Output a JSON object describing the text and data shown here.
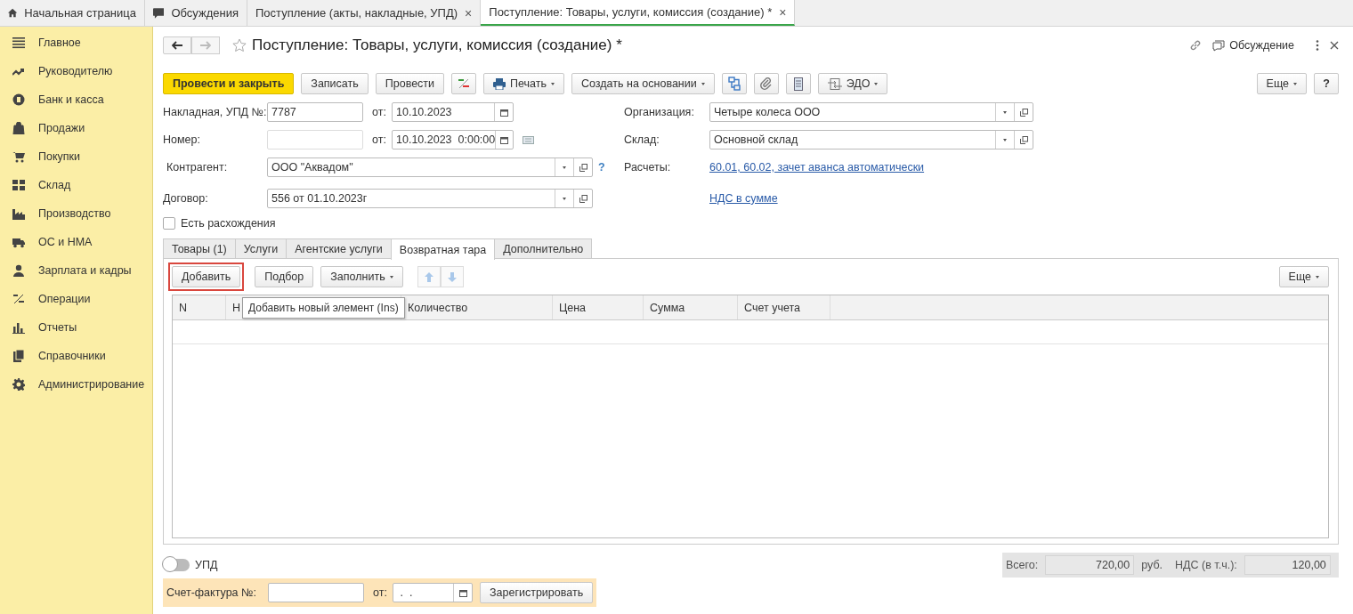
{
  "top_tabs": [
    {
      "label": "Начальная страница",
      "selected": false
    },
    {
      "label": "Обсуждения",
      "selected": false
    },
    {
      "label": "Поступление (акты, накладные, УПД)",
      "close": "×",
      "selected": false
    },
    {
      "label": "Поступление: Товары, услуги, комиссия (создание) *",
      "close": "×",
      "selected": true
    }
  ],
  "sidebar": {
    "items": [
      {
        "label": "Главное"
      },
      {
        "label": "Руководителю"
      },
      {
        "label": "Банк и касса"
      },
      {
        "label": "Продажи"
      },
      {
        "label": "Покупки"
      },
      {
        "label": "Склад"
      },
      {
        "label": "Производство"
      },
      {
        "label": "ОС и НМА"
      },
      {
        "label": "Зарплата и кадры"
      },
      {
        "label": "Операции"
      },
      {
        "label": "Отчеты"
      },
      {
        "label": "Справочники"
      },
      {
        "label": "Администрирование"
      }
    ]
  },
  "form": {
    "title": "Поступление: Товары, услуги, комиссия (создание) *",
    "discussion": "Обсуждение",
    "toolbar": [
      {
        "kind": "primary",
        "label": "Провести и закрыть"
      },
      {
        "kind": "plain",
        "label": "Записать"
      },
      {
        "kind": "plain",
        "label": "Провести"
      },
      {
        "kind": "icon"
      },
      {
        "kind": "dropdown",
        "label": "Печать"
      },
      {
        "kind": "dropdown",
        "label": "Создать на основании"
      },
      {
        "kind": "icon"
      },
      {
        "kind": "icon"
      },
      {
        "kind": "icon"
      },
      {
        "kind": "dropdown",
        "label": "ЭДО"
      }
    ],
    "more": "Еще",
    "help": "?",
    "invoice": {
      "label": "Накладная, УПД №:",
      "value": "7787",
      "date_label": "от:",
      "date": "10.10.2023"
    },
    "number": {
      "label": "Номер:",
      "date_label": "от:",
      "date": "10.10.2023  0:00:00"
    },
    "counterparty": {
      "label": "Контрагент:",
      "value": "ООО \"Аквадом\"",
      "hint": "?"
    },
    "contract": {
      "label": "Договор:",
      "value": "556 от 01.10.2023г"
    },
    "discrepancy": {
      "label": "Есть расхождения",
      "checked": false
    },
    "organization": {
      "label": "Организация:",
      "value": "Четыре колеса ООО"
    },
    "warehouse": {
      "label": "Склад:",
      "value": "Основной склад"
    },
    "settlements": {
      "label": "Расчеты:",
      "link": "60.01, 60.02, зачет аванса автоматически"
    },
    "vat_link": "НДС в сумме"
  },
  "tabs": [
    {
      "label": "Товары (1)",
      "selected": false
    },
    {
      "label": "Услуги",
      "selected": false
    },
    {
      "label": "Агентские услуги",
      "selected": false
    },
    {
      "label": "Возвратная тара",
      "selected": true
    },
    {
      "label": "Дополнительно",
      "selected": false
    }
  ],
  "table_toolbar": {
    "add": {
      "label": "Добавить",
      "highlighted": true
    },
    "pick": "Подбор",
    "fill": "Заполнить",
    "more": "Еще"
  },
  "table": {
    "columns": [
      "N",
      "Н",
      "Количество",
      "Цена",
      "Сумма",
      "Счет учета"
    ],
    "tooltip": "Добавить новый элемент (Ins)"
  },
  "upd_toggle": {
    "label": "УПД",
    "on": false
  },
  "totals": {
    "total_label": "Всего:",
    "total": "720,00",
    "currency": "руб.",
    "vat_label": "НДС (в т.ч.):",
    "vat": "120,00"
  },
  "invoice_band": {
    "label": "Счет-фактура №:",
    "date_label": "от:",
    "date": " .  .",
    "button": "Зарегистрировать"
  }
}
